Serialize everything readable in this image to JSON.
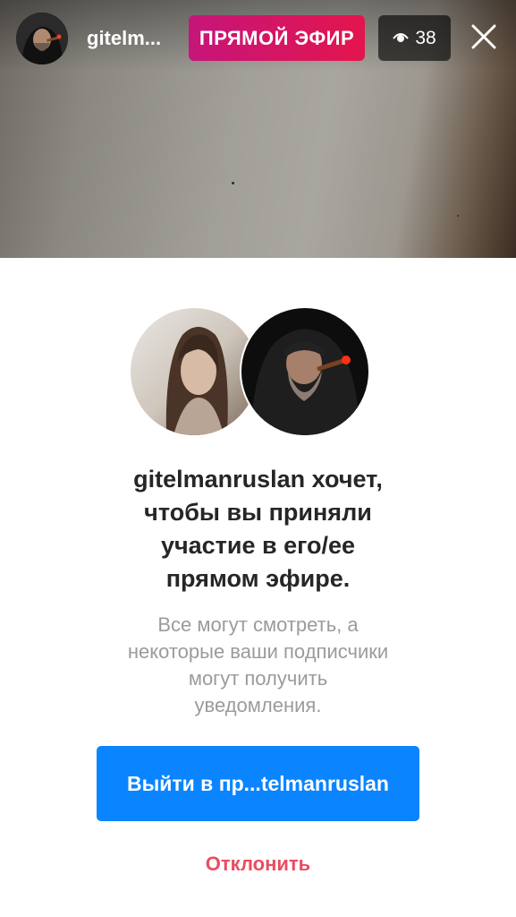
{
  "header": {
    "host_name": "gitelm...",
    "live_badge": "ПРЯМОЙ ЭФИР",
    "viewer_count": "38"
  },
  "invite": {
    "heading_lines": [
      "gitelmanruslan хочет,",
      "чтобы вы приняли",
      "участие в его/ее",
      "прямом эфире."
    ],
    "subtext_lines": [
      "Все могут смотреть, а",
      "некоторые ваши подписчики",
      "могут получить",
      "уведомления."
    ],
    "join_button": "Выйти в пр...telmanruslan",
    "decline_button": "Отклонить"
  },
  "colors": {
    "live_badge": "#d3156a",
    "primary_button": "#0a85ff",
    "decline_text": "#ec4c5f"
  }
}
